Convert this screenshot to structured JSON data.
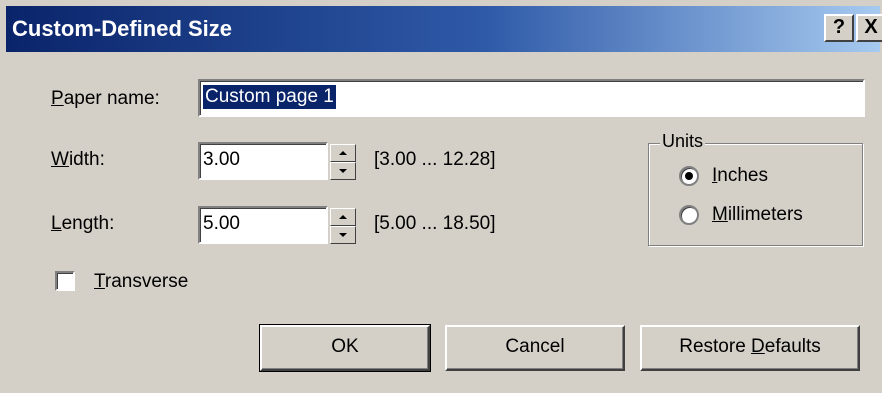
{
  "window": {
    "title": "Custom-Defined Size",
    "help_label": "?",
    "close_label": "X"
  },
  "paper_name": {
    "label": "Paper name:",
    "value": "Custom page 1"
  },
  "width": {
    "label": "Width:",
    "value": "3.00",
    "range": "[3.00 ... 12.28]"
  },
  "length": {
    "label": "Length:",
    "value": "5.00",
    "range": "[5.00 ... 18.50]"
  },
  "units": {
    "group_label": "Units",
    "options": [
      {
        "label": "Inches",
        "selected": true
      },
      {
        "label": "Millimeters",
        "selected": false
      }
    ]
  },
  "transverse": {
    "label": "Transverse",
    "checked": false
  },
  "buttons": {
    "ok": "OK",
    "cancel": "Cancel",
    "restore_defaults": "Restore Defaults"
  },
  "colors": {
    "face": "#d4d0c8",
    "titlebar_start": "#0a246a",
    "titlebar_end": "#a6caf0",
    "selection": "#0a246a"
  }
}
